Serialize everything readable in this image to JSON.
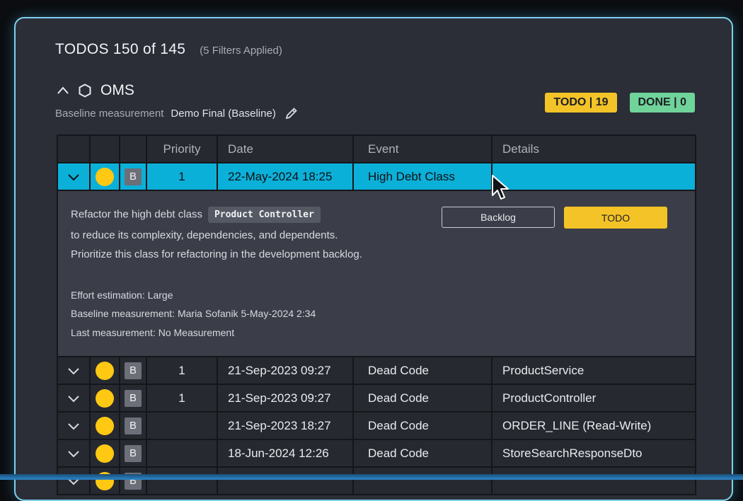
{
  "header": {
    "title": "TODOS 150 of 145",
    "filters_note": "(5 Filters Applied)"
  },
  "project": {
    "name": "OMS",
    "baseline_label": "Baseline measurement",
    "baseline_value": "Demo Final (Baseline)"
  },
  "badges": {
    "todo": "TODO | 19",
    "done": "DONE | 0"
  },
  "colors": {
    "accent_selected": "#0bb0d8",
    "todo_yellow": "#f4c327",
    "done_green": "#6fd39a",
    "dot_yellow": "#ffc813",
    "border": "#7fd0ea"
  },
  "icons": {
    "collapse": "chevron-up-icon",
    "project": "hexagon-icon",
    "edit": "pencil-icon",
    "expand": "chevron-down-icon",
    "severity": "yellow-circle-icon",
    "cursor": "mouse-pointer-icon"
  },
  "table": {
    "columns": [
      "",
      "",
      "",
      "Priority",
      "Date",
      "Event",
      "Details"
    ],
    "selected": {
      "badge": "B",
      "priority": "1",
      "date": "22-May-2024 18:25",
      "event": "High Debt Class",
      "details": ""
    },
    "detail": {
      "line1_prefix": "Refactor the high debt class",
      "class_name": "Product Controller",
      "line2": "to reduce its complexity, dependencies, and dependents.",
      "line3": "Prioritize this class for refactoring in the development backlog.",
      "effort": "Effort estimation: Large",
      "baseline": "Baseline measurement: Maria Sofanik 5-May-2024 2:34",
      "last": "Last measurement: No Measurement",
      "backlog_button": "Backlog",
      "todo_button": "TODO"
    },
    "rows": [
      {
        "badge": "B",
        "priority": "1",
        "date": "21-Sep-2023 09:27",
        "event": "Dead Code",
        "details": "ProductService"
      },
      {
        "badge": "B",
        "priority": "1",
        "date": "21-Sep-2023 09:27",
        "event": "Dead Code",
        "details": "ProductController"
      },
      {
        "badge": "B",
        "priority": "",
        "date": "21-Sep-2023 18:27",
        "event": "Dead Code",
        "details": "ORDER_LINE (Read-Write)"
      },
      {
        "badge": "B",
        "priority": "",
        "date": "18-Jun-2024 12:26",
        "event": "Dead Code",
        "details": "StoreSearchResponseDto"
      },
      {
        "badge": "B",
        "priority": "",
        "date": "",
        "event": "",
        "details": ""
      }
    ]
  }
}
